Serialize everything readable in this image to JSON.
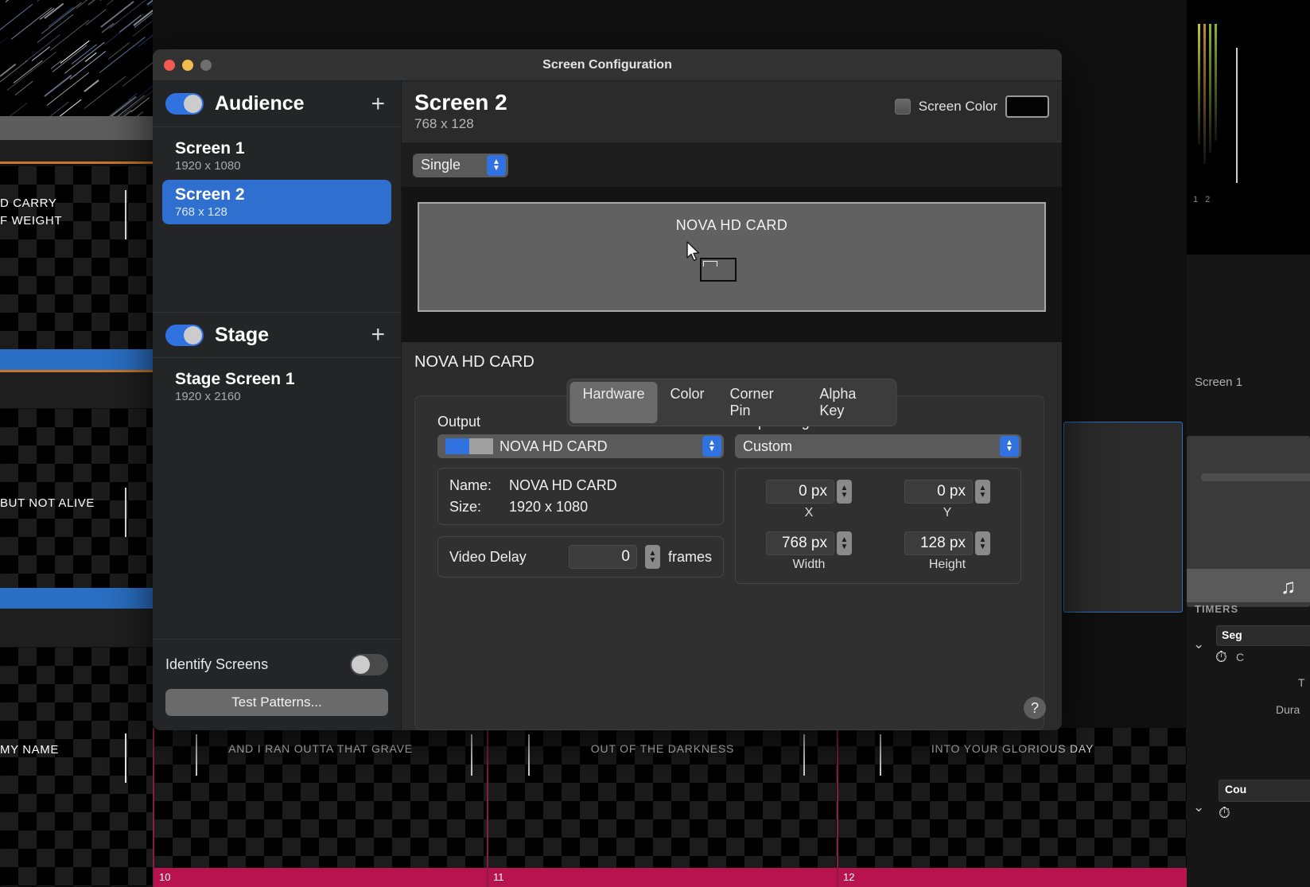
{
  "window": {
    "title": "Screen Configuration",
    "traffic_lights": [
      "close-red",
      "minimize-yellow",
      "zoom-gray"
    ]
  },
  "sidebar": {
    "audience": {
      "title": "Audience",
      "toggle_on": true,
      "add_label": "+",
      "screens": [
        {
          "name": "Screen 1",
          "resolution": "1920 x 1080",
          "selected": false
        },
        {
          "name": "Screen 2",
          "resolution": "768 x 128",
          "selected": true
        }
      ]
    },
    "stage": {
      "title": "Stage",
      "toggle_on": true,
      "add_label": "+",
      "screens": [
        {
          "name": "Stage Screen 1",
          "resolution": "1920 x 2160",
          "selected": false
        }
      ]
    },
    "identify_screens": {
      "label": "Identify Screens",
      "toggle_on": false
    },
    "test_patterns_label": "Test Patterns..."
  },
  "main": {
    "title": "Screen 2",
    "resolution": "768 x 128",
    "screen_color": {
      "label": "Screen Color",
      "checked": false,
      "color": "#050505"
    },
    "mode_popup": {
      "value": "Single"
    },
    "canvas": {
      "card_label": "NOVA HD CARD"
    },
    "detail_title": "NOVA HD CARD",
    "tabs": [
      {
        "label": "Hardware",
        "active": true
      },
      {
        "label": "Color",
        "active": false
      },
      {
        "label": "Corner Pin",
        "active": false
      },
      {
        "label": "Alpha Key",
        "active": false
      }
    ],
    "output": {
      "label": "Output",
      "value": "NOVA HD CARD",
      "swatch_a": "#2f72e0",
      "swatch_b": "#a0a0a0",
      "name_label": "Name:",
      "name_value": "NOVA HD CARD",
      "size_label": "Size:",
      "size_value": "1920 x 1080",
      "video_delay_label": "Video Delay",
      "video_delay_value": "0",
      "video_delay_unit": "frames"
    },
    "output_target": {
      "label": "Output Target",
      "value": "Custom",
      "fields": [
        {
          "label": "X",
          "value": "0 px"
        },
        {
          "label": "Y",
          "value": "0 px"
        },
        {
          "label": "Width",
          "value": "768 px"
        },
        {
          "label": "Height",
          "value": "128 px"
        }
      ]
    },
    "help_label": "?"
  },
  "background": {
    "left_slides": [
      {
        "lines": [
          "D CARRY",
          "F WEIGHT"
        ]
      },
      {
        "lines": [
          "BUT NOT ALIVE"
        ]
      },
      {
        "lines": [
          "MY NAME"
        ]
      }
    ],
    "bottom_slides": [
      {
        "lyric": "AND I RAN OUTTA THAT GRAVE",
        "number": "10"
      },
      {
        "lyric": "OUT OF THE DARKNESS",
        "number": "11"
      },
      {
        "lyric": "INTO YOUR GLORIOUS DAY",
        "number": "12"
      }
    ],
    "right_panel": {
      "screen_label": "Screen 1",
      "timers_label": "TIMERS",
      "segment_label": "Seg",
      "timer_row_label": "C",
      "time_label": "T",
      "duration_label": "Dura",
      "countdown_label": "Cou",
      "meter_scale": "1 2"
    }
  }
}
